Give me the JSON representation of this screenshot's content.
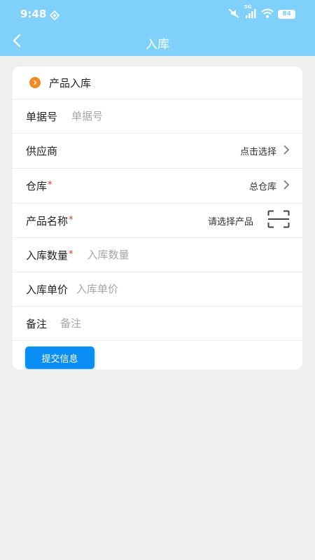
{
  "status_bar": {
    "time": "9:48",
    "network_label": "5G",
    "battery": "84"
  },
  "nav": {
    "title": "入库"
  },
  "form": {
    "section_title": "产品入库",
    "doc_no": {
      "label": "单据号",
      "placeholder": "单据号"
    },
    "supplier": {
      "label": "供应商",
      "value": "点击选择"
    },
    "warehouse": {
      "label": "仓库",
      "required_mark": "*",
      "value": "总仓库"
    },
    "product_name": {
      "label": "产品名称",
      "required_mark": "*",
      "value": "请选择产品"
    },
    "quantity": {
      "label": "入库数量",
      "required_mark": "*",
      "placeholder": "入库数量"
    },
    "unit_price": {
      "label": "入库单价",
      "placeholder": "入库单价"
    },
    "remark": {
      "label": "备注",
      "placeholder": "备注"
    },
    "submit_label": "提交信息"
  },
  "colors": {
    "header_bg": "#7fd0fb",
    "accent_orange": "#f08a24",
    "required_red": "#e5382f",
    "button_blue": "#0a8df5",
    "page_bg": "#efefef"
  },
  "icons": {
    "back": "chevron-left-icon",
    "section": "chevron-right-circle-icon",
    "picker_arrow": "chevron-right-icon",
    "scan": "scan-icon"
  }
}
